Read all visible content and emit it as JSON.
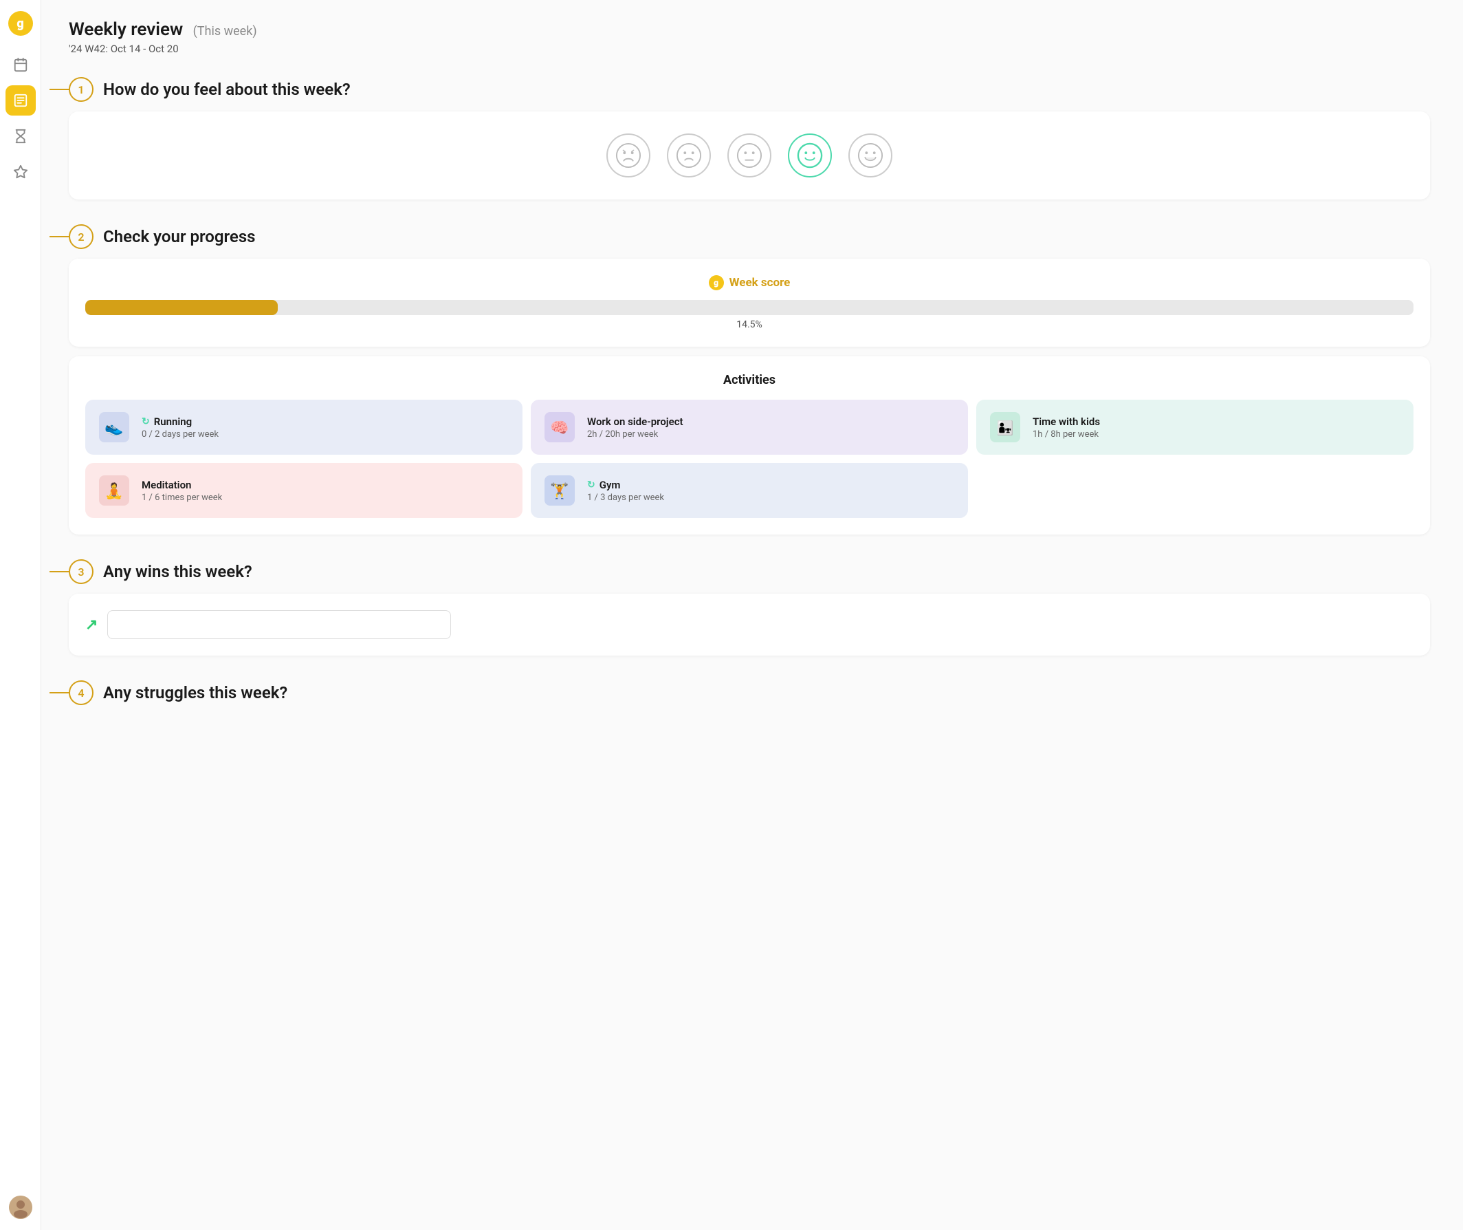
{
  "sidebar": {
    "logo_letter": "g",
    "items": [
      {
        "name": "calendar",
        "icon": "📅",
        "active": false
      },
      {
        "name": "review",
        "icon": "📋",
        "active": true
      },
      {
        "name": "hourglass",
        "icon": "⏳",
        "active": false
      },
      {
        "name": "star",
        "icon": "☆",
        "active": false
      }
    ]
  },
  "header": {
    "title": "Weekly review",
    "title_badge": "(This week)",
    "subtitle": "'24 W42: Oct 14 - Oct 20"
  },
  "section1": {
    "number": "1",
    "title": "How do you feel about this week?",
    "moods": [
      {
        "id": "very-sad",
        "emoji": "😢",
        "selected": false
      },
      {
        "id": "sad",
        "emoji": "😕",
        "selected": false
      },
      {
        "id": "neutral",
        "emoji": "😐",
        "selected": false
      },
      {
        "id": "happy",
        "emoji": "🙂",
        "selected": true
      },
      {
        "id": "very-happy",
        "emoji": "😄",
        "selected": false
      }
    ]
  },
  "section2": {
    "number": "2",
    "title": "Check your progress",
    "week_score": {
      "label": "Week score",
      "percent": 14.5,
      "percent_label": "14.5%"
    },
    "activities": {
      "title": "Activities",
      "items": [
        {
          "name": "Running",
          "progress": "0 / 2 days per week",
          "color": "blue",
          "emoji": "👟",
          "has_refresh": true,
          "refresh_color": "green"
        },
        {
          "name": "Work on side-project",
          "progress": "2h / 20h per week",
          "color": "purple",
          "emoji": "🧠",
          "has_refresh": false,
          "refresh_color": ""
        },
        {
          "name": "Time with kids",
          "progress": "1h / 8h per week",
          "color": "teal",
          "emoji": "👨‍👧‍👦",
          "has_refresh": false,
          "refresh_color": ""
        },
        {
          "name": "Meditation",
          "progress": "1 / 6 times per week",
          "color": "pink",
          "emoji": "🧘",
          "has_refresh": false,
          "refresh_color": ""
        },
        {
          "name": "Gym",
          "progress": "1 / 3 days per week",
          "color": "blue2",
          "emoji": "🏋️",
          "has_refresh": true,
          "refresh_color": "blue"
        }
      ]
    }
  },
  "section3": {
    "number": "3",
    "title": "Any wins this week?",
    "input_placeholder": ""
  },
  "section4": {
    "number": "4",
    "title": "Any struggles this week?"
  }
}
